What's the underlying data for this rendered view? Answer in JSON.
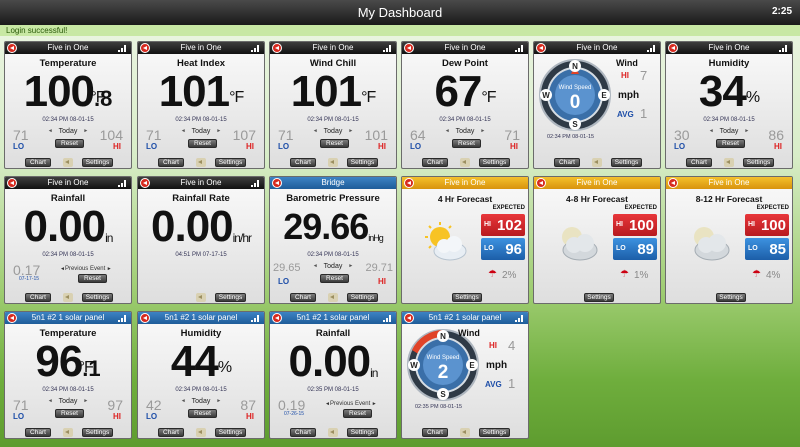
{
  "app": {
    "title": "My Dashboard",
    "time": "2:25",
    "status": "Login successful!"
  },
  "tiles": {
    "temp": {
      "header": "Five in One",
      "title": "Temperature",
      "value": "100",
      "dec": ".8",
      "unit": "°F",
      "timestamp": "02:34 PM 08-01-15",
      "min": "71",
      "max": "104",
      "lo": "LO",
      "hi": "HI",
      "today": "Today",
      "reset": "Reset",
      "chart": "Chart",
      "settings": "Settings"
    },
    "heat": {
      "header": "Five in One",
      "title": "Heat Index",
      "value": "101",
      "unit": "°F",
      "timestamp": "02:34 PM 08-01-15",
      "min": "71",
      "max": "107",
      "lo": "LO",
      "hi": "HI",
      "today": "Today",
      "reset": "Reset",
      "chart": "Chart",
      "settings": "Settings"
    },
    "chill": {
      "header": "Five in One",
      "title": "Wind Chill",
      "value": "101",
      "unit": "°F",
      "timestamp": "02:34 PM 08-01-15",
      "min": "71",
      "max": "101",
      "lo": "LO",
      "hi": "HI",
      "today": "Today",
      "reset": "Reset",
      "chart": "Chart",
      "settings": "Settings"
    },
    "dew": {
      "header": "Five in One",
      "title": "Dew Point",
      "value": "67",
      "unit": "°F",
      "timestamp": "02:34 PM 08-01-15",
      "min": "64",
      "max": "71",
      "lo": "LO",
      "hi": "HI",
      "today": "Today",
      "reset": "Reset",
      "chart": "Chart",
      "settings": "Settings"
    },
    "wind1": {
      "header": "Five in One",
      "title": "Wind",
      "speed_label": "Wind Speed",
      "speed": "0",
      "n": "N",
      "s": "S",
      "e": "E",
      "w": "W",
      "hi_label": "HI",
      "hi": "7",
      "unit": "mph",
      "avg_label": "AVG",
      "avg": "1",
      "timestamp": "02:34 PM 08-01-15",
      "chart": "Chart",
      "settings": "Settings"
    },
    "hum1": {
      "header": "Five in One",
      "title": "Humidity",
      "value": "34",
      "unit": "%",
      "timestamp": "02:34 PM 08-01-15",
      "min": "30",
      "max": "86",
      "lo": "LO",
      "hi": "HI",
      "today": "Today",
      "reset": "Reset",
      "chart": "Chart",
      "settings": "Settings"
    },
    "rain1": {
      "header": "Five in One",
      "title": "Rainfall",
      "value": "0.00",
      "unit": "in",
      "timestamp": "02:34 PM 08-01-15",
      "prev": "0.17",
      "prev_date": "07-17-15",
      "prev_label": "Previous Event",
      "reset": "Reset",
      "chart": "Chart",
      "settings": "Settings"
    },
    "rate": {
      "header": "Five in One",
      "title": "Rainfall Rate",
      "value": "0.00",
      "unit": "in/hr",
      "timestamp": "04:51 PM 07-17-15",
      "settings": "Settings"
    },
    "baro": {
      "header": "Bridge",
      "title": "Barometric Pressure",
      "value": "29.66",
      "unit": "inHg",
      "timestamp": "02:34 PM 08-01-15",
      "min": "29.65",
      "max": "29.71",
      "lo": "LO",
      "hi": "HI",
      "today": "Today",
      "reset": "Reset",
      "chart": "Chart",
      "settings": "Settings"
    },
    "f4": {
      "header": "Five in One",
      "title": "4 Hr Forecast",
      "expected": "EXPECTED",
      "hi_label": "HI",
      "hi": "102",
      "lo_label": "LO",
      "lo": "96",
      "pct": "2%",
      "settings": "Settings"
    },
    "f48": {
      "header": "Five in One",
      "title": "4-8 Hr Forecast",
      "expected": "EXPECTED",
      "hi_label": "HI",
      "hi": "100",
      "lo_label": "LO",
      "lo": "89",
      "pct": "1%",
      "settings": "Settings"
    },
    "f812": {
      "header": "Five in One",
      "title": "8-12 Hr Forecast",
      "expected": "EXPECTED",
      "hi_label": "HI",
      "hi": "100",
      "lo_label": "LO",
      "lo": "85",
      "pct": "4%",
      "settings": "Settings"
    },
    "temp2": {
      "header": "5n1 #2 1 solar panel",
      "title": "Temperature",
      "value": "96",
      "dec": ".1",
      "unit": "°F",
      "timestamp": "02:34 PM 08-01-15",
      "min": "71",
      "max": "97",
      "lo": "LO",
      "hi": "HI",
      "today": "Today",
      "reset": "Reset",
      "chart": "Chart",
      "settings": "Settings"
    },
    "hum2": {
      "header": "5n1 #2 1 solar panel",
      "title": "Humidity",
      "value": "44",
      "unit": "%",
      "timestamp": "02:34 PM 08-01-15",
      "min": "42",
      "max": "87",
      "lo": "LO",
      "hi": "HI",
      "today": "Today",
      "reset": "Reset",
      "chart": "Chart",
      "settings": "Settings"
    },
    "rain2": {
      "header": "5n1 #2 1 solar panel",
      "title": "Rainfall",
      "value": "0.00",
      "unit": "in",
      "timestamp": "02:35 PM 08-01-15",
      "prev": "0.19",
      "prev_date": "07-26-15",
      "prev_label": "Previous Event",
      "reset": "Reset",
      "chart": "Chart",
      "settings": "Settings"
    },
    "wind2": {
      "header": "5n1 #2 1 solar panel",
      "title": "Wind",
      "speed_label": "Wind Speed",
      "speed": "2",
      "n": "N",
      "s": "S",
      "e": "E",
      "w": "W",
      "hi_label": "HI",
      "hi": "4",
      "unit": "mph",
      "avg_label": "AVG",
      "avg": "1",
      "timestamp": "02:35 PM 08-01-15",
      "chart": "Chart",
      "settings": "Settings"
    }
  },
  "icons": {
    "back": "back-arrow-icon",
    "signal": "signal-strength-icon",
    "sound": "speaker-icon",
    "forecast_sun": "partly-sunny-icon",
    "forecast_cloud": "cloudy-icon",
    "rain": "umbrella-icon"
  },
  "colors": {
    "header_dark": "#1a1a1a",
    "header_blue": "#2a6eb0",
    "header_gold": "#f0b020",
    "hi": "#dd2222",
    "lo": "#1e4ea8"
  }
}
